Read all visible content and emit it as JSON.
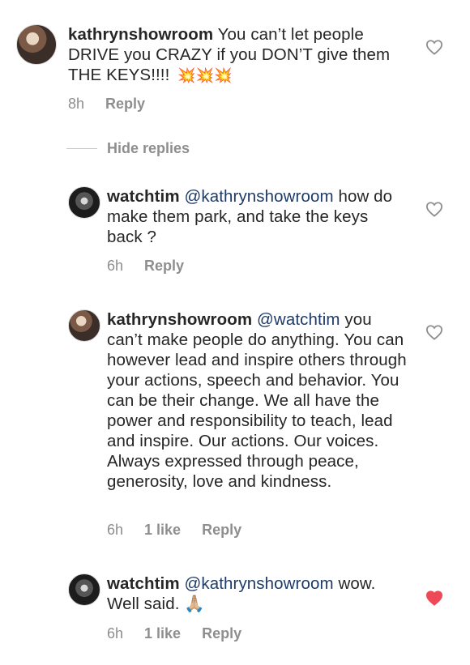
{
  "comments": [
    {
      "username": "kathrynshowroom",
      "text": " You can’t let people DRIVE you CRAZY if you DON’T give them THE KEYS!!!! ",
      "emoji": "💥💥💥",
      "time": "8h",
      "reply_label": "Reply",
      "liked": false
    }
  ],
  "hide_replies_label": "Hide replies",
  "replies": [
    {
      "username": "watchtim",
      "mention": "@kathrynshowroom",
      "text": " how do make them park, and take the keys back ?",
      "time": "6h",
      "likes": "",
      "reply_label": "Reply",
      "liked": false
    },
    {
      "username": "kathrynshowroom",
      "mention": "@watchtim",
      "text": " you can’t make people do anything. You can however lead and inspire others through your actions, speech and behavior. You can be their change. We all have the power and responsibility to teach, lead and inspire. Our actions. Our voices. Always expressed through peace, generosity, love and kindness.",
      "time": "6h",
      "likes": "1 like",
      "reply_label": "Reply",
      "liked": false
    },
    {
      "username": "watchtim",
      "mention": "@kathrynshowroom",
      "text": " wow. Well said. ",
      "emoji": "🙏🏼",
      "time": "6h",
      "likes": "1 like",
      "reply_label": "Reply",
      "liked": true
    }
  ],
  "colors": {
    "heart_liked": "#ed4956",
    "heart_outline": "#8e8e8e",
    "mention": "#1e3a66"
  }
}
